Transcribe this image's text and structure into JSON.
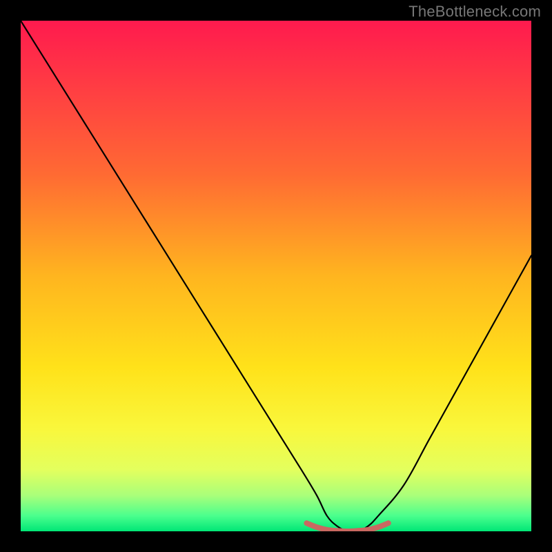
{
  "watermark": "TheBottleneck.com",
  "colors": {
    "background": "#000000",
    "curve": "#000000",
    "marker": "#c96861",
    "gradient_stops": [
      {
        "offset": 0.0,
        "color": "#ff1a4e"
      },
      {
        "offset": 0.12,
        "color": "#ff3a44"
      },
      {
        "offset": 0.3,
        "color": "#ff6a33"
      },
      {
        "offset": 0.5,
        "color": "#ffb51f"
      },
      {
        "offset": 0.68,
        "color": "#ffe21a"
      },
      {
        "offset": 0.8,
        "color": "#f9f73c"
      },
      {
        "offset": 0.88,
        "color": "#e3ff5e"
      },
      {
        "offset": 0.93,
        "color": "#a9ff7a"
      },
      {
        "offset": 0.97,
        "color": "#4aff8d"
      },
      {
        "offset": 1.0,
        "color": "#00e676"
      }
    ]
  },
  "chart_data": {
    "type": "line",
    "title": "",
    "xlabel": "",
    "ylabel": "",
    "xlim": [
      0,
      100
    ],
    "ylim": [
      0,
      100
    ],
    "grid": false,
    "legend": null,
    "series": [
      {
        "name": "bottleneck-curve",
        "x": [
          0,
          5,
          10,
          15,
          20,
          25,
          30,
          35,
          40,
          45,
          50,
          55,
          58,
          60,
          62,
          64,
          66,
          68,
          70,
          75,
          80,
          85,
          90,
          95,
          100
        ],
        "y": [
          100,
          92,
          84,
          76,
          68,
          60,
          52,
          44,
          36,
          28,
          20,
          12,
          7,
          3,
          1,
          0,
          0,
          1,
          3,
          9,
          18,
          27,
          36,
          45,
          54
        ]
      },
      {
        "name": "optimal-marker",
        "x": [
          56,
          58,
          60,
          62,
          64,
          66,
          68,
          70,
          72
        ],
        "y": [
          1.6,
          0.8,
          0.3,
          0.1,
          0.0,
          0.1,
          0.3,
          0.8,
          1.6
        ]
      }
    ]
  }
}
